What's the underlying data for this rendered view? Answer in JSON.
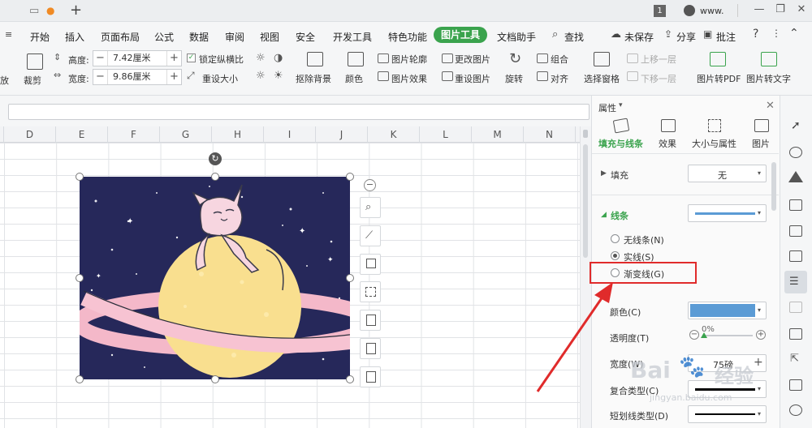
{
  "titlebar": {
    "new_tab_symbol": "+",
    "page_badge": "1",
    "url_fragment": "www."
  },
  "menu": {
    "collapse_symbol": "≡",
    "items": [
      "开始",
      "插入",
      "页面布局",
      "公式",
      "数据",
      "审阅",
      "视图",
      "安全",
      "开发工具",
      "特色功能"
    ],
    "active_tab": "图片工具",
    "after_items": [
      "文档助手"
    ],
    "search_label": "查找",
    "unsaved_label": "未保存",
    "share_label": "分享",
    "comment_label": "批注"
  },
  "ribbon": {
    "fit_label": "放",
    "crop_label": "裁剪",
    "height_label": "高度:",
    "height_value": "7.42厘米",
    "width_label": "宽度:",
    "width_value": "9.86厘米",
    "lock_ratio_label": "锁定纵横比",
    "reset_size_label": "重设大小",
    "remove_bg_label": "抠除背景",
    "color_label": "颜色",
    "outline_label": "图片轮廓",
    "effect_label": "图片效果",
    "change_pic_label": "更改图片",
    "reset_pic_label": "重设图片",
    "rotate_label": "旋转",
    "group_label": "组合",
    "align_label": "对齐",
    "select_pane_label": "选择窗格",
    "bring_forward_label": "上移一层",
    "send_backward_label": "下移一层",
    "to_pdf_label": "图片转PDF",
    "to_text_label": "图片转文字"
  },
  "sheet": {
    "columns": [
      "D",
      "E",
      "F",
      "G",
      "H",
      "I",
      "J",
      "K",
      "L",
      "M",
      "N"
    ]
  },
  "pane": {
    "title": "属性",
    "tabs": [
      "填充与线条",
      "效果",
      "大小与属性",
      "图片"
    ],
    "fill_label": "填充",
    "fill_value": "无",
    "line_label": "线条",
    "radio_none": "无线条(N)",
    "radio_solid": "实线(S)",
    "radio_gradient": "渐变线(G)",
    "color_label": "颜色(C)",
    "opacity_label": "透明度(T)",
    "opacity_value": "0%",
    "width_label": "宽度(W)",
    "width_value": "75磅",
    "compound_label": "复合类型(C)",
    "dash_label": "短划线类型(D)",
    "line_color": "#5b9bd5",
    "accent_color": "#3aa34d",
    "highlight_color": "#e02b2b"
  },
  "watermark": {
    "brand": "Bai",
    "brand_sub": "经验",
    "url": "jingyan.baidu.com"
  }
}
